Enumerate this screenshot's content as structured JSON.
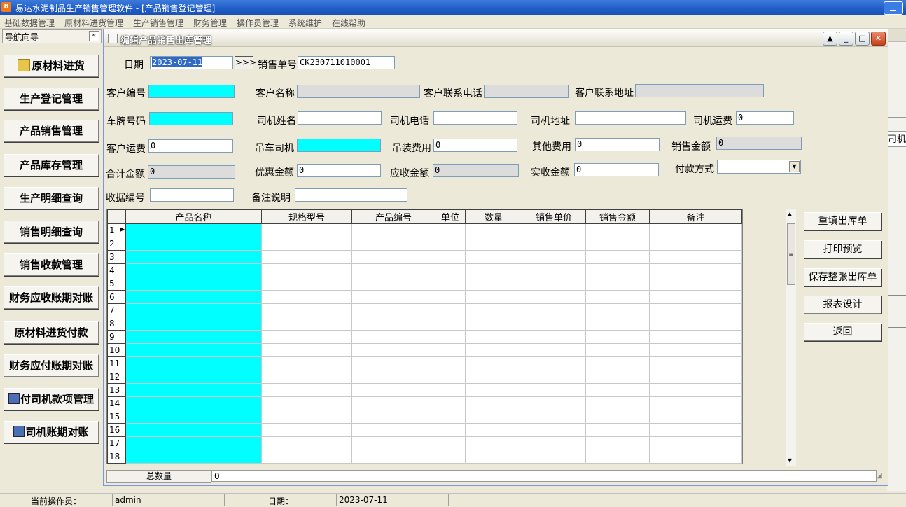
{
  "app": {
    "title": "易达水泥制品生产销售管理软件  - [产品销售登记管理]"
  },
  "menu": [
    "基础数据管理",
    "原材料进货管理",
    "生产销售管理",
    "财务管理",
    "操作员管理",
    "系统维护",
    "在线帮助"
  ],
  "nav": {
    "header": "导航向导",
    "collapse": "«",
    "items": [
      "原材料进货",
      "生产登记管理",
      "产品销售管理",
      "产品库存管理",
      "生产明细查询",
      "销售明细查询",
      "销售收款管理",
      "财务应收账期对账",
      "原材料进货付款",
      "财务应付账期对账",
      "付司机款项管理",
      "司机账期对账"
    ]
  },
  "window": {
    "title": "编辑产品销售出库管理"
  },
  "form": {
    "date_label": "日期",
    "date_value": "2023-07-11",
    "date_btn": ">>>",
    "order_no_label": "销售单号",
    "order_no_value": "CK230711010001",
    "customer_id_label": "客户编号",
    "customer_name_label": "客户名称",
    "customer_phone_label": "客户联系电话",
    "customer_addr_label": "客户联系地址",
    "plate_label": "车牌号码",
    "driver_name_label": "司机姓名",
    "driver_phone_label": "司机电话",
    "driver_addr_label": "司机地址",
    "driver_freight_label": "司机运费",
    "driver_freight_value": "0",
    "customer_freight_label": "客户运费",
    "customer_freight_value": "0",
    "crane_driver_label": "吊车司机",
    "crane_fee_label": "吊装费用",
    "crane_fee_value": "0",
    "other_fee_label": "其他费用",
    "other_fee_value": "0",
    "sales_amount_label": "销售金额",
    "sales_amount_value": "0",
    "total_amount_label": "合计金额",
    "total_amount_value": "0",
    "discount_label": "优惠金额",
    "discount_value": "0",
    "receivable_label": "应收金额",
    "receivable_value": "0",
    "received_label": "实收金额",
    "received_value": "0",
    "payment_label": "付款方式",
    "receipt_no_label": "收据编号",
    "remark_label": "备注说明"
  },
  "grid": {
    "columns": [
      "产品名称",
      "规格型号",
      "产品编号",
      "单位",
      "数量",
      "销售单价",
      "销售金额",
      "备注"
    ],
    "rows": [
      "1",
      "2",
      "3",
      "4",
      "5",
      "6",
      "7",
      "8",
      "9",
      "10",
      "11",
      "12",
      "13",
      "14",
      "15",
      "16",
      "17",
      "18"
    ],
    "total_label": "总数量",
    "total_value": "0"
  },
  "actions": [
    "重填出库单",
    "打印预览",
    "保存整张出库单",
    "报表设计",
    "返回"
  ],
  "status": {
    "operator_label": "当前操作员：",
    "operator_value": "admin",
    "date_label": "日期：",
    "date_value": "2023-07-11"
  },
  "bg_window": {
    "text": "司机联"
  }
}
